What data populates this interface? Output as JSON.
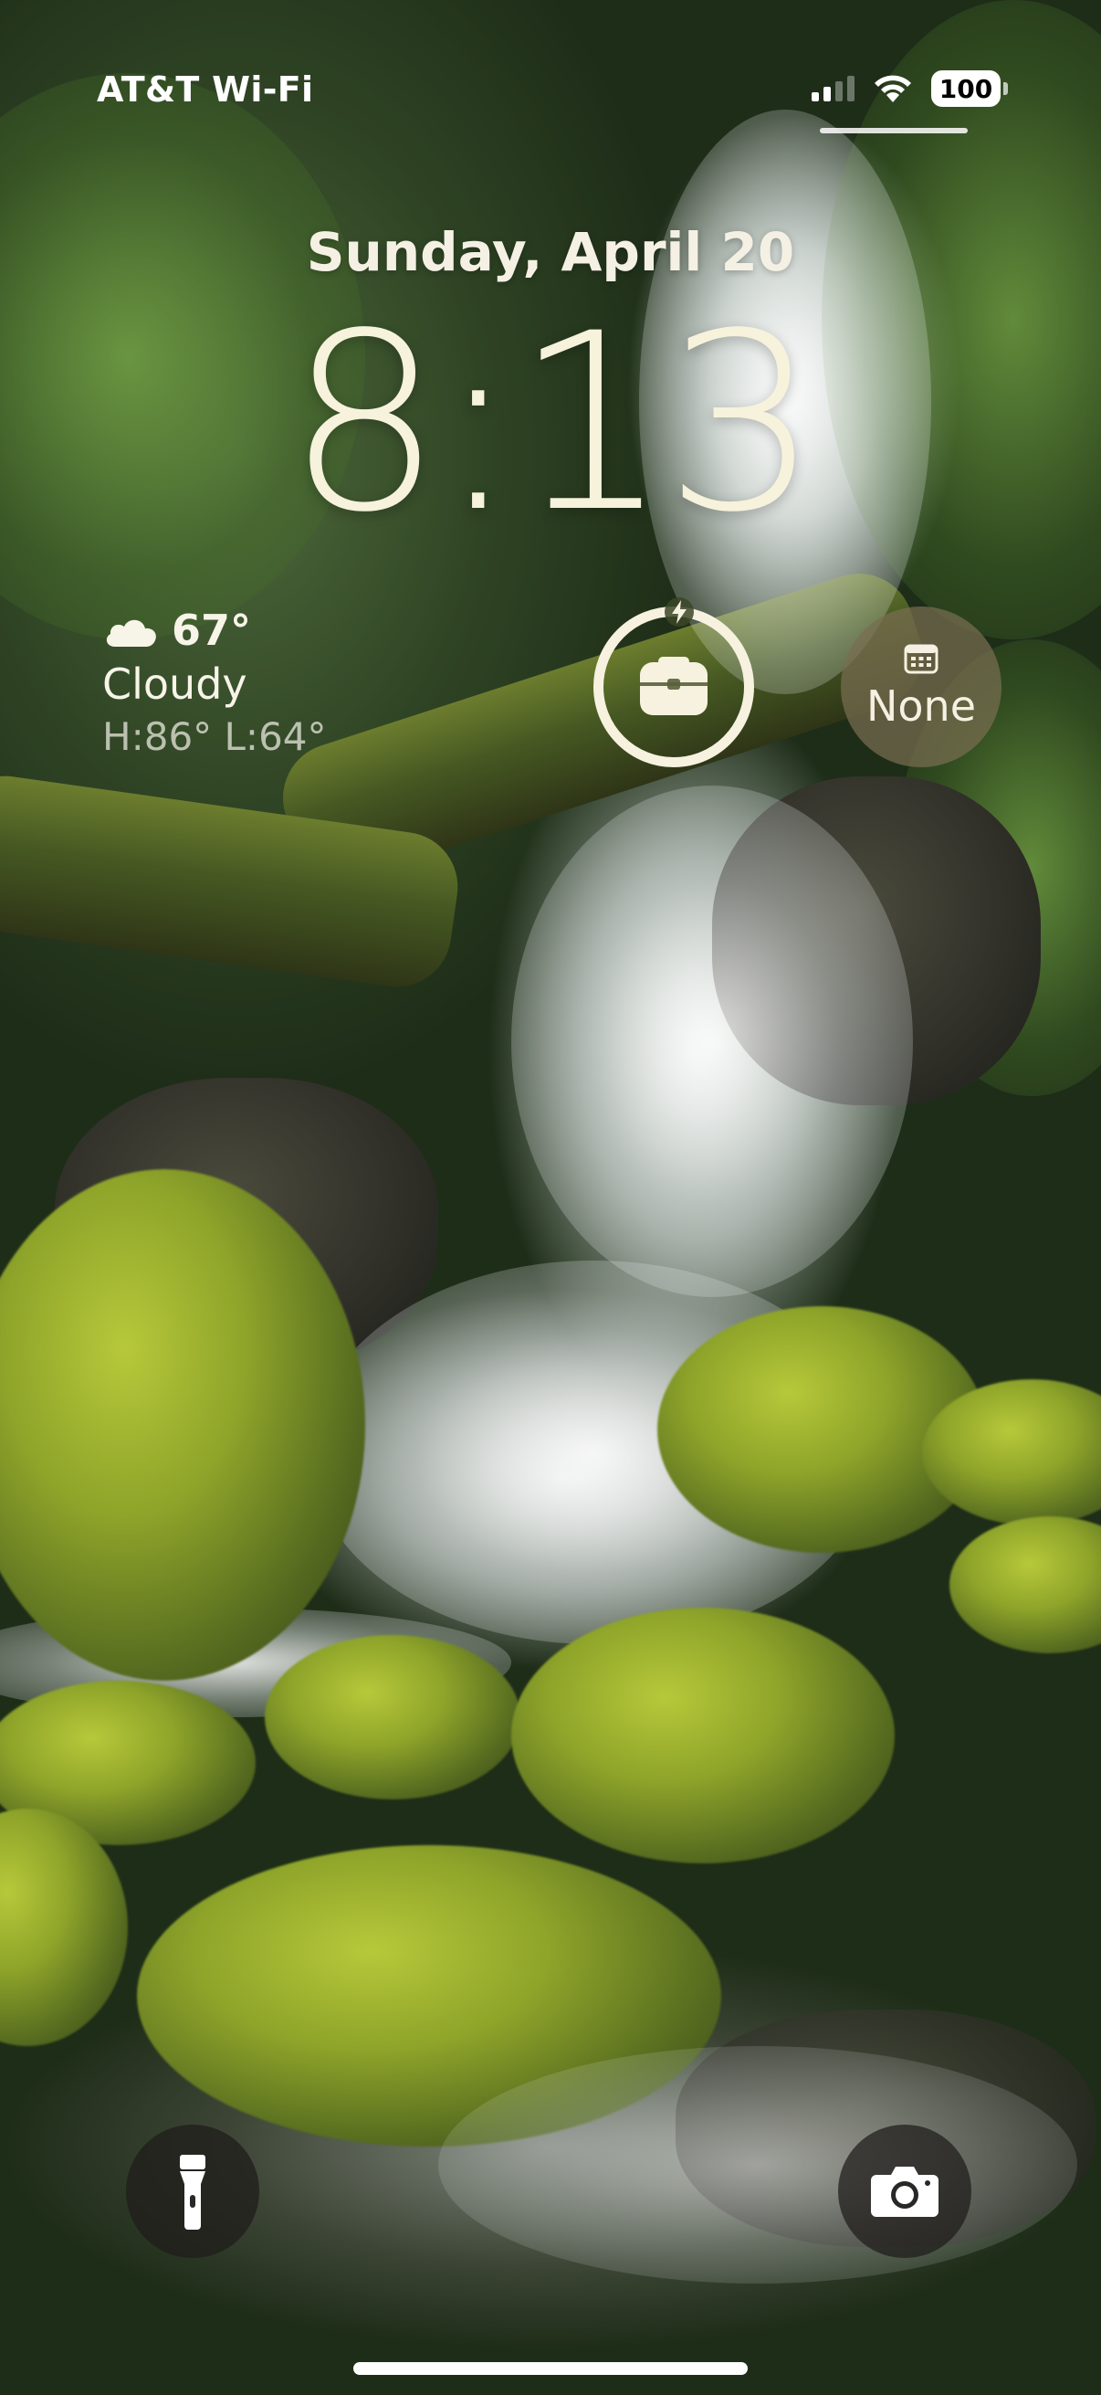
{
  "status_bar": {
    "carrier": "AT&T Wi-Fi",
    "signal_icon": "cellular-signal-icon",
    "signal_bars_active": 2,
    "signal_bars_total": 4,
    "wifi_icon": "wifi-icon",
    "battery_percent": "100"
  },
  "lock_screen": {
    "date": "Sunday, April 20",
    "time": "8:13"
  },
  "weather_widget": {
    "icon": "cloudy-icon",
    "temperature": "67°",
    "condition": "Cloudy",
    "high_low": "H:86° L:64°"
  },
  "battery_widget": {
    "icon": "battery-case-icon",
    "charging_icon": "charging-bolt-icon"
  },
  "calendar_widget": {
    "icon": "calendar-icon",
    "label": "None"
  },
  "quick_actions": {
    "flashlight_icon": "flashlight-icon",
    "camera_icon": "camera-icon"
  },
  "colors": {
    "clock_text": "#f6f2dc",
    "widget_ring": "#f6f2df",
    "calendar_bg": "#786e50",
    "button_bg": "#1e1c1a"
  }
}
